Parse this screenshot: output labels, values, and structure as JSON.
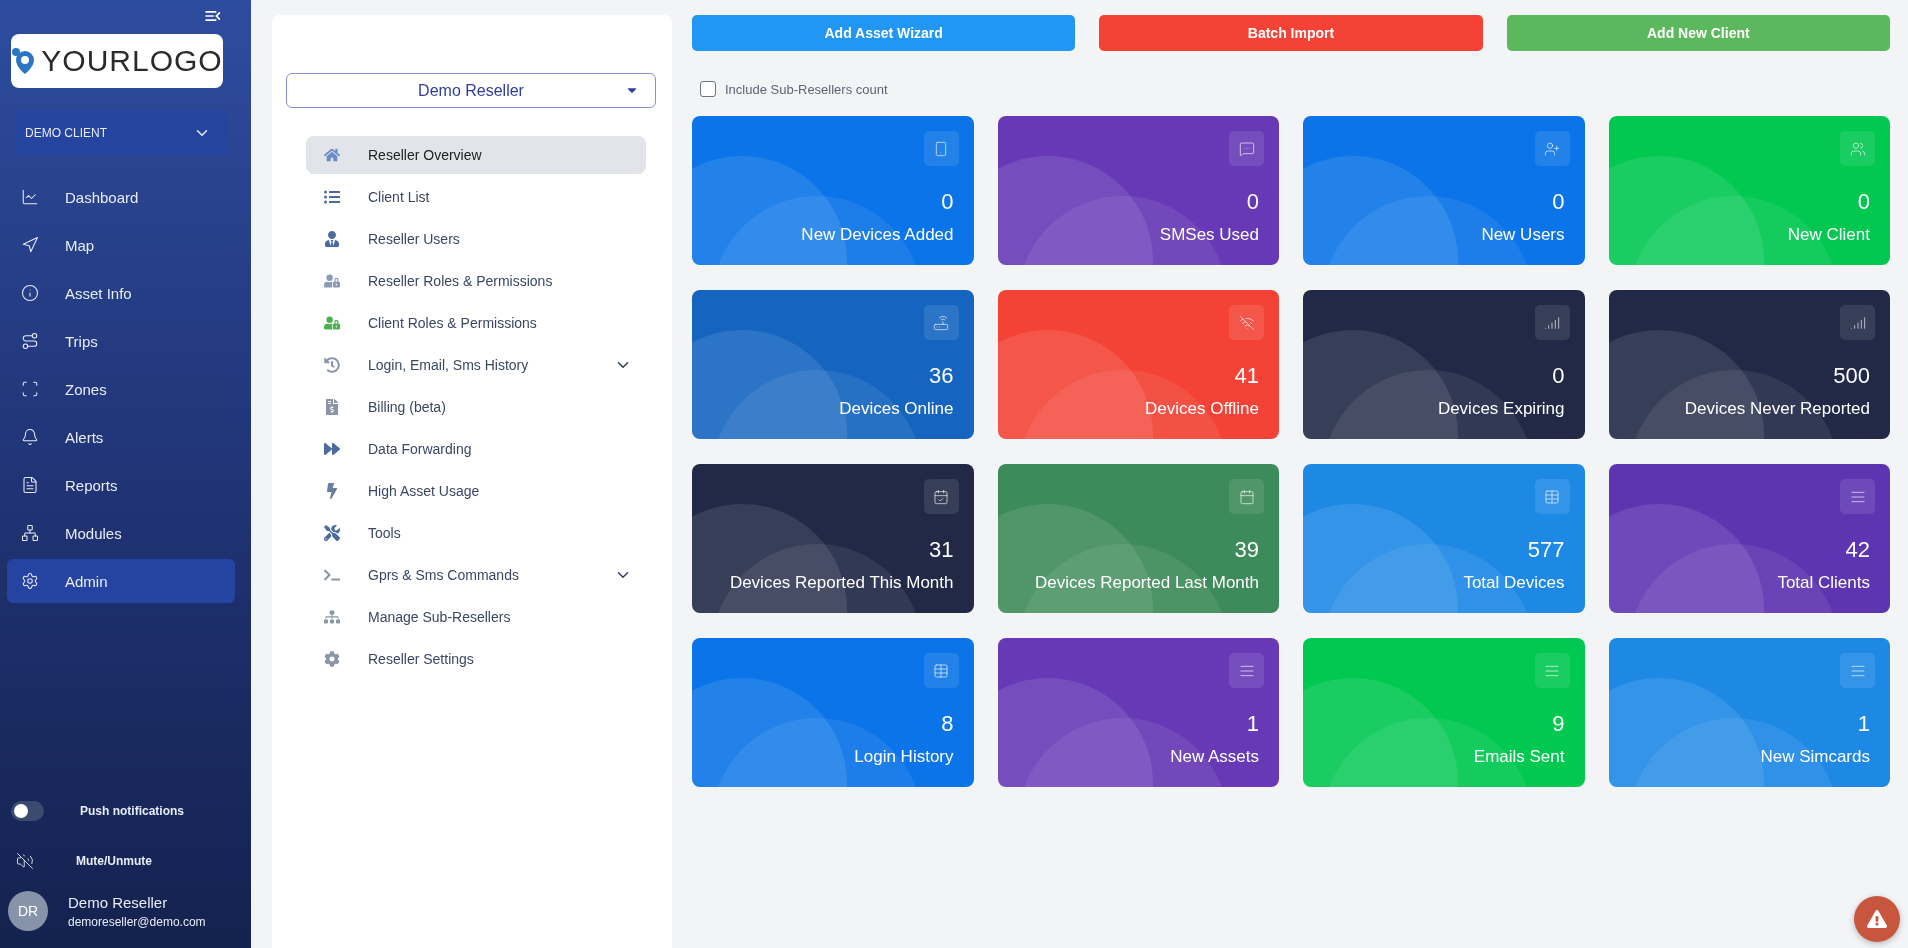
{
  "sidebar": {
    "logo": "**YOUR**LOGO",
    "client_select": "DEMO CLIENT",
    "items": [
      {
        "label": "Dashboard",
        "selected": false
      },
      {
        "label": "Map",
        "selected": false
      },
      {
        "label": "Asset Info",
        "selected": false
      },
      {
        "label": "Trips",
        "selected": false
      },
      {
        "label": "Zones",
        "selected": false
      },
      {
        "label": "Alerts",
        "selected": false
      },
      {
        "label": "Reports",
        "selected": false
      },
      {
        "label": "Modules",
        "selected": false
      },
      {
        "label": "Admin",
        "selected": true
      }
    ],
    "push_notifications": {
      "label": "Push notifications",
      "on": false
    },
    "mute": {
      "label": "Mute/Unmute"
    },
    "user": {
      "initials": "DR",
      "name": "Demo Reseller",
      "email": "demoreseller@demo.com"
    }
  },
  "reseller_panel": {
    "select": "Demo Reseller",
    "items": [
      {
        "label": "Reseller Overview",
        "selected": true
      },
      {
        "label": "Client List",
        "selected": false
      },
      {
        "label": "Reseller Users",
        "selected": false
      },
      {
        "label": "Reseller Roles & Permissions",
        "selected": false
      },
      {
        "label": "Client Roles & Permissions",
        "selected": false
      },
      {
        "label": "Login, Email, Sms History",
        "selected": false,
        "expanded": false
      },
      {
        "label": "Billing (beta)",
        "selected": false
      },
      {
        "label": "Data Forwarding",
        "selected": false
      },
      {
        "label": "High Asset Usage",
        "selected": false
      },
      {
        "label": "Tools",
        "selected": false
      },
      {
        "label": "Gprs & Sms Commands",
        "selected": false,
        "expanded": false
      },
      {
        "label": "Manage Sub-Resellers",
        "selected": false
      },
      {
        "label": "Reseller Settings",
        "selected": false
      }
    ]
  },
  "actions": [
    {
      "label": "Add Asset Wizard",
      "color": "#2196f3"
    },
    {
      "label": "Batch Import",
      "color": "#f44336"
    },
    {
      "label": "Add New Client",
      "color": "#5cb85c"
    }
  ],
  "include_sub_resellers": {
    "label": "Include Sub-Resellers count",
    "checked": false
  },
  "cards": [
    {
      "value": "0",
      "label": "New Devices Added",
      "color": "#0a74e8"
    },
    {
      "value": "0",
      "label": "SMSes Used",
      "color": "#6739b6"
    },
    {
      "value": "0",
      "label": "New Users",
      "color": "#0a74e8"
    },
    {
      "value": "0",
      "label": "New Client",
      "color": "#00c851"
    },
    {
      "value": "36",
      "label": "Devices Online",
      "color": "#1565c0"
    },
    {
      "value": "41",
      "label": "Devices Offline",
      "color": "#f44336"
    },
    {
      "value": "0",
      "label": "Devices Expiring",
      "color": "#212946"
    },
    {
      "value": "500",
      "label": "Devices Never Reported",
      "color": "#212946"
    },
    {
      "value": "31",
      "label": "Devices Reported This Month",
      "color": "#212946"
    },
    {
      "value": "39",
      "label": "Devices Reported Last Month",
      "color": "#3d8b5a"
    },
    {
      "value": "577",
      "label": "Total Devices",
      "color": "#1e88e5"
    },
    {
      "value": "42",
      "label": "Total Clients",
      "color": "#5e35b1"
    },
    {
      "value": "8",
      "label": "Login History",
      "color": "#0a74e8"
    },
    {
      "value": "1",
      "label": "New Assets",
      "color": "#6739b6"
    },
    {
      "value": "9",
      "label": "Emails Sent",
      "color": "#00c851"
    },
    {
      "value": "1",
      "label": "New Simcards",
      "color": "#1e88e5"
    }
  ]
}
